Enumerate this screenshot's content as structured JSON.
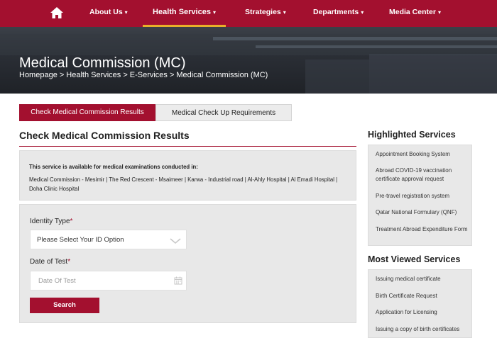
{
  "colors": {
    "brand": "#a3102f",
    "accent": "#e8b02a",
    "panel": "#e8e8e8"
  },
  "nav": {
    "home_icon": "home-icon",
    "items": [
      {
        "label": "About Us"
      },
      {
        "label": "Health Services"
      },
      {
        "label": "Strategies"
      },
      {
        "label": "Departments"
      },
      {
        "label": "Media Center"
      }
    ],
    "active_item": "Health Services"
  },
  "hero": {
    "title": "Medical Commission (MC)",
    "breadcrumb": [
      "Homepage",
      "Health Services",
      "E-Services",
      "Medical Commission (MC)"
    ],
    "separator": ">"
  },
  "tabs": [
    {
      "label": "Check Medical Commission Results",
      "active": true
    },
    {
      "label": "Medical Check Up Requirements",
      "active": false
    }
  ],
  "section": {
    "title": "Check Medical Commission Results"
  },
  "info": {
    "heading": "This service is available for medical examinations conducted in:",
    "body": "Medical Commission - Mesimir | The Red Crescent - Msaimeer | Karwa - Industrial road | Al-Ahly Hospital | Al Emadi Hospital | Doha Clinic Hospital"
  },
  "form": {
    "identity_label": "Identity Type",
    "identity_value": "Please Select Your ID Option",
    "date_label": "Date of Test",
    "date_placeholder": "Date Of Test",
    "required_mark": "*",
    "search_label": "Search"
  },
  "sidebar": {
    "highlighted_title": "Highlighted Services",
    "highlighted": [
      {
        "label": "Appointment Booking System"
      },
      {
        "label": "Abroad COVID-19 vaccination certificate approval request"
      },
      {
        "label": "Pre-travel registration system"
      },
      {
        "label": "Qatar National Formulary (QNF)"
      },
      {
        "label": "Treatment Abroad Expenditure Form"
      }
    ],
    "most_viewed_title": "Most Viewed Services",
    "most_viewed": [
      {
        "label": "Issuing medical certificate"
      },
      {
        "label": "Birth Certificate Request"
      },
      {
        "label": "Application for Licensing"
      },
      {
        "label": "Issuing a copy of birth certificates"
      }
    ]
  }
}
